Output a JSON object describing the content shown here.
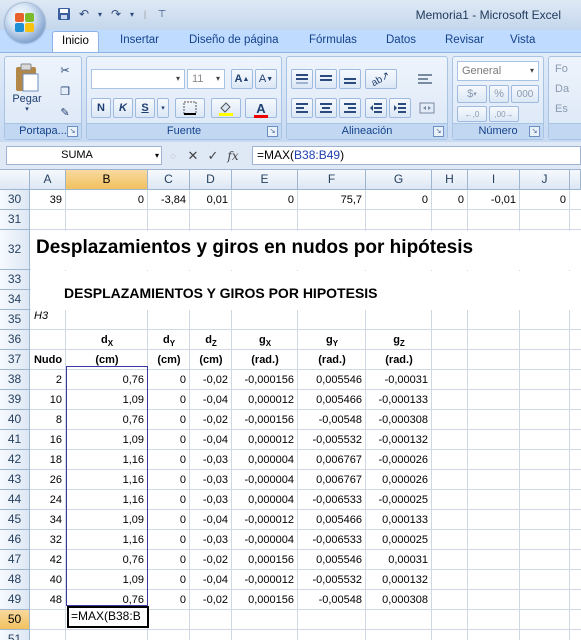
{
  "window": {
    "title": "Memoria1 - Microsoft Excel"
  },
  "qat": {
    "icons": [
      "save-icon",
      "undo-icon",
      "redo-icon",
      "customize-icon"
    ]
  },
  "ribbon": {
    "tabs": [
      "Inicio",
      "Insertar",
      "Diseño de página",
      "Fórmulas",
      "Datos",
      "Revisar",
      "Vista"
    ],
    "active_tab": "Inicio",
    "groups": {
      "clipboard": {
        "label": "Portapa...",
        "paste_label": "Pegar"
      },
      "font": {
        "label": "Fuente",
        "size": "11",
        "bold": "N",
        "italic": "K",
        "underline": "S"
      },
      "alignment": {
        "label": "Alineación"
      },
      "number": {
        "label": "Número",
        "format": "General",
        "currency": "$",
        "percent": "%",
        "thousands": "000"
      },
      "styles": {
        "items": [
          "Fo",
          "Da",
          "Es"
        ]
      }
    }
  },
  "formula_bar": {
    "name_box": "SUMA",
    "formula_prefix": "=MAX(",
    "formula_ref": "B38:B49",
    "formula_suffix": ")"
  },
  "grid": {
    "columns": [
      "A",
      "B",
      "C",
      "D",
      "E",
      "F",
      "G",
      "H",
      "I",
      "J"
    ],
    "rows": [
      "30",
      "31",
      "32",
      "33",
      "34",
      "35",
      "36",
      "37",
      "38",
      "39",
      "40",
      "41",
      "42",
      "43",
      "44",
      "45",
      "46",
      "47",
      "48",
      "49",
      "50",
      "51"
    ],
    "row30": [
      "39",
      "0",
      "-3,84",
      "0,01",
      "0",
      "75,7",
      "0",
      "0",
      "-0,01",
      "0"
    ],
    "title": "Desplazamientos y giros en nudos por hipótesis",
    "subtitle": "DESPLAZAMIENTOS Y GIROS POR HIPOTESIS",
    "hypothesis": "H3",
    "headers": {
      "row1": [
        {
          "main": "d",
          "sub": "X"
        },
        {
          "main": "d",
          "sub": "Y"
        },
        {
          "main": "d",
          "sub": "Z"
        },
        {
          "main": "g",
          "sub": "X"
        },
        {
          "main": "g",
          "sub": "Y"
        },
        {
          "main": "g",
          "sub": "Z"
        }
      ],
      "nudo": "Nudo",
      "units": [
        "(cm)",
        "(cm)",
        "(cm)",
        "(rad.)",
        "(rad.)",
        "(rad.)"
      ]
    },
    "data": [
      [
        "2",
        "0,76",
        "0",
        "-0,02",
        "-0,000156",
        "0,005546",
        "-0,00031"
      ],
      [
        "10",
        "1,09",
        "0",
        "-0,04",
        "0,000012",
        "0,005466",
        "-0,000133"
      ],
      [
        "8",
        "0,76",
        "0",
        "-0,02",
        "-0,000156",
        "-0,00548",
        "-0,000308"
      ],
      [
        "16",
        "1,09",
        "0",
        "-0,04",
        "0,000012",
        "-0,005532",
        "-0,000132"
      ],
      [
        "18",
        "1,16",
        "0",
        "-0,03",
        "0,000004",
        "0,006767",
        "-0,000026"
      ],
      [
        "26",
        "1,16",
        "0",
        "-0,03",
        "-0,000004",
        "0,006767",
        "0,000026"
      ],
      [
        "24",
        "1,16",
        "0",
        "-0,03",
        "0,000004",
        "-0,006533",
        "-0,000025"
      ],
      [
        "34",
        "1,09",
        "0",
        "-0,04",
        "-0,000012",
        "0,005466",
        "0,000133"
      ],
      [
        "32",
        "1,16",
        "0",
        "-0,03",
        "-0,000004",
        "-0,006533",
        "0,000025"
      ],
      [
        "42",
        "0,76",
        "0",
        "-0,02",
        "0,000156",
        "0,005546",
        "0,00031"
      ],
      [
        "40",
        "1,09",
        "0",
        "-0,04",
        "-0,000012",
        "-0,005532",
        "0,000132"
      ],
      [
        "48",
        "0,76",
        "0",
        "-0,02",
        "0,000156",
        "-0,00548",
        "0,000308"
      ]
    ],
    "active_cell_text": "=MAX(B38:B",
    "selected_column": "B",
    "selected_row": "50"
  },
  "colors": {
    "accent": "#3a3aa0",
    "header_selected": "#f1c15f",
    "ribbon_bg": "#d1e1f5"
  }
}
